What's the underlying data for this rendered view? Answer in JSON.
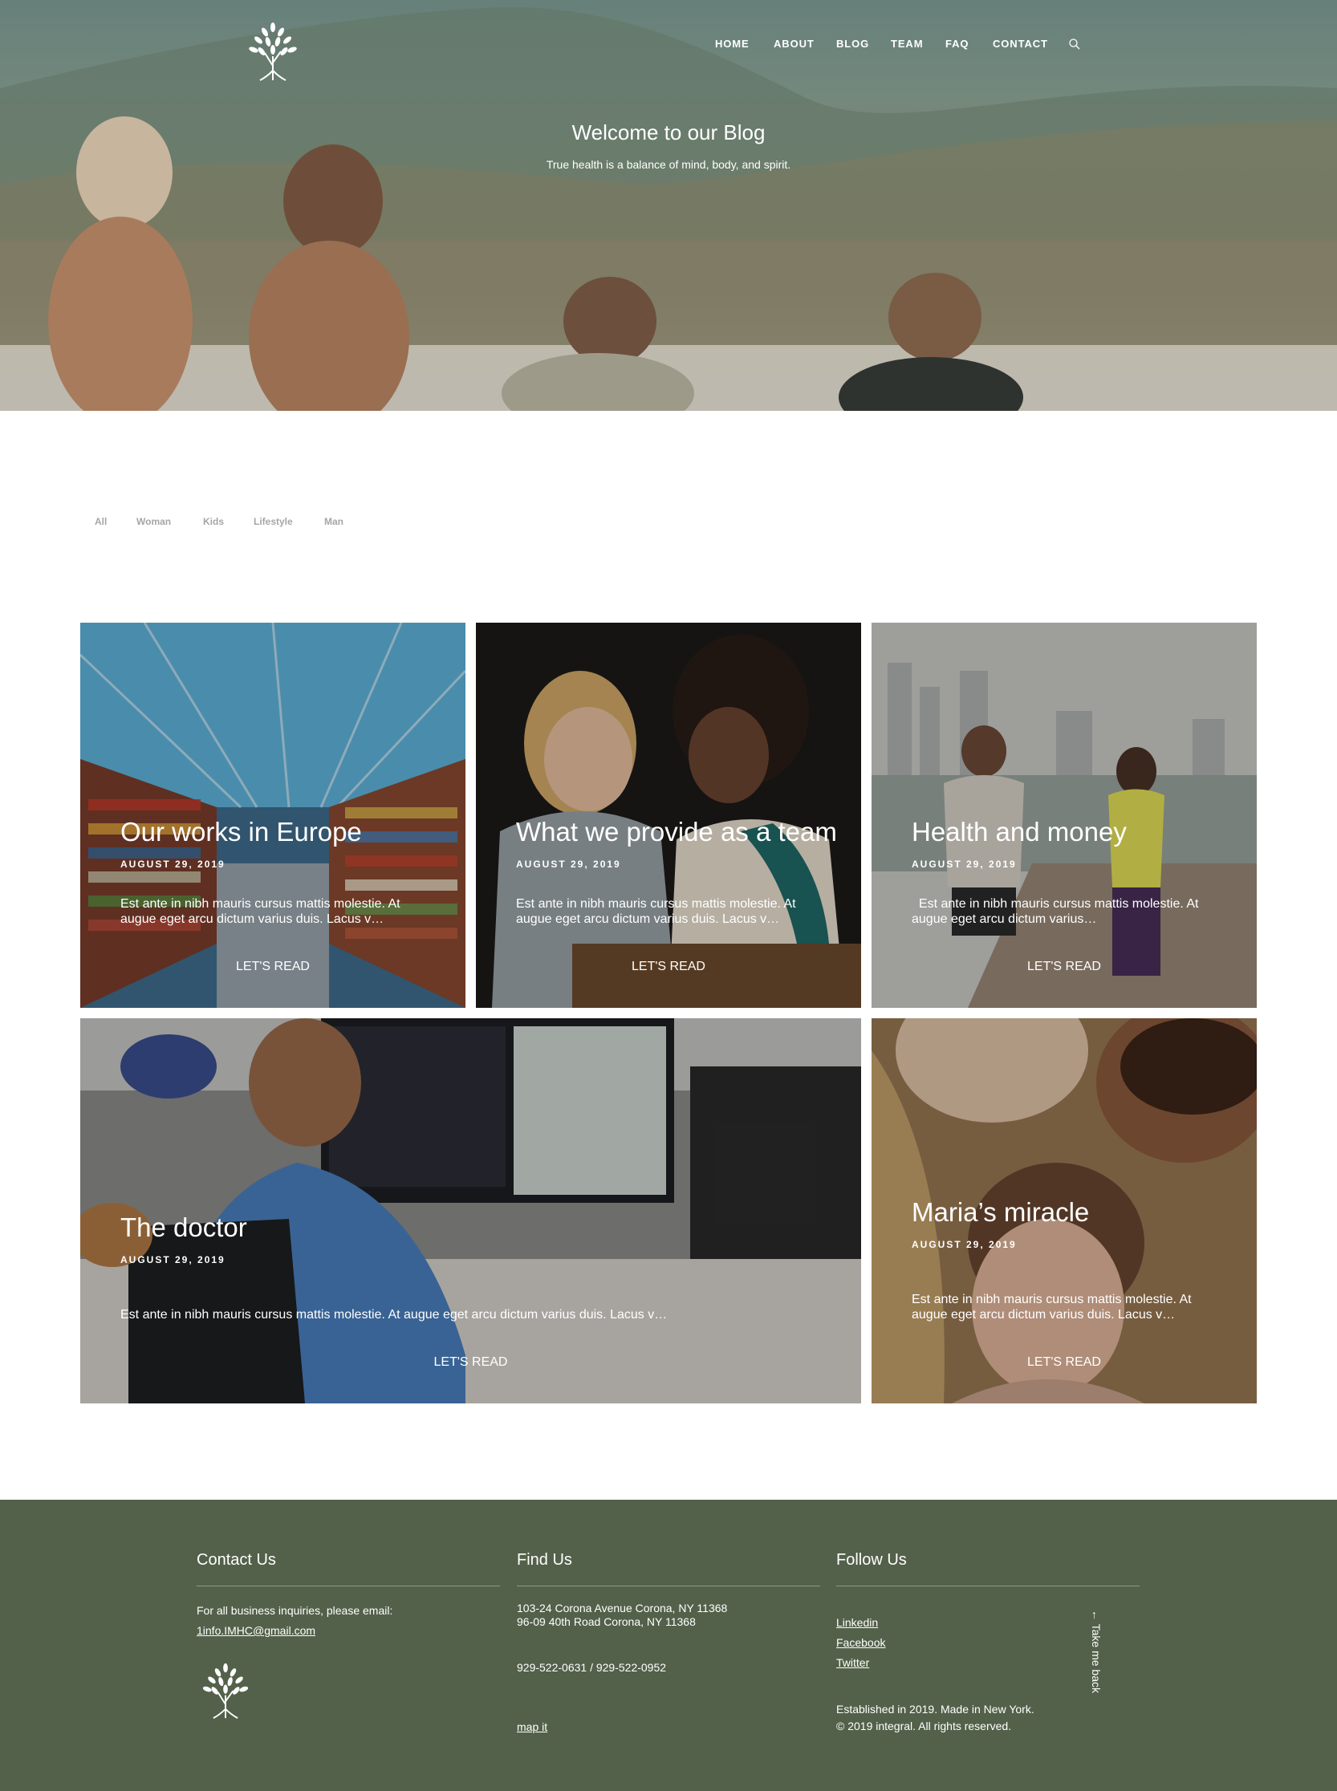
{
  "nav": {
    "items": [
      "HOME",
      "ABOUT",
      "BLOG",
      "TEAM",
      "FAQ",
      "CONTACT"
    ],
    "search_icon": "search-icon",
    "logo_icon": "tree-logo-icon"
  },
  "hero": {
    "title": "Welcome to our Blog",
    "subtitle": "True health is a balance of mind, body, and spirit."
  },
  "filters": [
    "All",
    "Woman",
    "Kids",
    "Lifestyle",
    "Man"
  ],
  "posts": [
    {
      "title": "Our works in Europe",
      "date": "AUGUST 29, 2019",
      "excerpt1": "Est ante in nibh mauris cursus mattis molestie. At",
      "excerpt2": "augue eget arcu dictum varius duis. Lacus v…",
      "cta": "LET'S READ",
      "image": "library-bookshelves"
    },
    {
      "title": "What we provide as a team",
      "date": "AUGUST 29, 2019",
      "excerpt1": "Est ante in nibh mauris cursus mattis molestie. At",
      "excerpt2": "augue eget arcu dictum varius duis. Lacus v…",
      "cta": "LET'S READ",
      "image": "two-women-tablet"
    },
    {
      "title": "Health and money",
      "date": "AUGUST 29, 2019",
      "excerpt1": "  Est ante in nibh mauris cursus mattis molestie. At",
      "excerpt2": "augue eget arcu dictum varius…",
      "cta": "LET'S READ",
      "image": "couple-jogging"
    },
    {
      "title": "The doctor",
      "date": "AUGUST 29, 2019",
      "excerpt1": "Est ante in nibh mauris cursus mattis molestie. At augue eget arcu dictum varius duis. Lacus v…",
      "excerpt2": "",
      "cta": "LET'S READ",
      "image": "office-computers"
    },
    {
      "title": "Maria’s miracle",
      "date": "AUGUST 29, 2019",
      "excerpt1": "Est ante in nibh mauris cursus mattis molestie. At",
      "excerpt2": "augue eget arcu dictum varius duis. Lacus v…",
      "cta": "LET'S READ",
      "image": "family-child"
    }
  ],
  "footer": {
    "contact": {
      "heading": "Contact Us",
      "text": "For all business inquiries, please email:",
      "email": "1info.IMHC@gmail.com"
    },
    "find": {
      "heading": "Find Us",
      "address1": "103-24 Corona Avenue Corona, NY 11368",
      "address2": "96-09 40th Road Corona, NY 11368",
      "phone": "929-522-0631 / 929-522-0952",
      "map_link": "map it"
    },
    "follow": {
      "heading": "Follow Us",
      "links": [
        "Linkedin",
        "Facebook",
        "Twitter"
      ],
      "established": "Established in 2019. Made in New York.",
      "copyright": "© 2019 integral. All rights reserved."
    },
    "back_to_top": "← Take me back"
  },
  "colors": {
    "footer_bg": "#53614a",
    "filter_text": "#a6a6a6"
  }
}
